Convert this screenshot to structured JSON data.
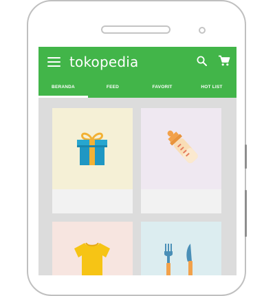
{
  "app": {
    "brand": "tokopedia",
    "accent_color": "#42b549"
  },
  "appbar": {
    "menu_icon": "hamburger-menu-icon",
    "search_icon": "search-icon",
    "cart_icon": "shopping-cart-icon"
  },
  "tabs": [
    {
      "label": "BERANDA",
      "selected": true
    },
    {
      "label": "FEED",
      "selected": false
    },
    {
      "label": "FAVORIT",
      "selected": false
    },
    {
      "label": "HOT LIST",
      "selected": false
    }
  ],
  "categories": [
    {
      "icon": "gift-icon",
      "background": "#f5f0d6"
    },
    {
      "icon": "baby-bottle-icon",
      "background": "#efe8f1"
    },
    {
      "icon": "tshirt-icon",
      "background": "#f7e5e0"
    },
    {
      "icon": "fork-knife-icon",
      "background": "#dcedf0"
    }
  ]
}
